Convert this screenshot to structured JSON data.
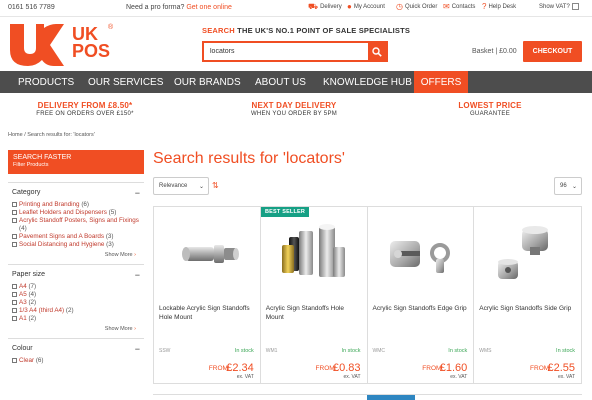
{
  "topbar": {
    "phone": "0161 516 7789",
    "proforma_text": "Need a pro forma?",
    "proforma_link": "Get one online",
    "links": [
      {
        "label": "Delivery",
        "icon": "truck-icon"
      },
      {
        "label": "My Account",
        "icon": "user-icon"
      },
      {
        "label": "Quick Order",
        "icon": "clock-icon"
      },
      {
        "label": "Contacts",
        "icon": "envelope-icon"
      },
      {
        "label": "Help Desk",
        "icon": "question-icon"
      }
    ],
    "vat_label": "Show VAT?"
  },
  "header": {
    "logo_text_1": "UK",
    "logo_text_2": "POS",
    "logo_reg": "®",
    "tagline_highlight": "SEARCH",
    "tagline_rest": "THE UK'S NO.1 POINT OF SALE SPECIALISTS",
    "search_value": "locators",
    "basket_label": "Basket",
    "basket_amount": "£0.00",
    "checkout_label": "CHECKOUT"
  },
  "nav": [
    "PRODUCTS",
    "OUR SERVICES",
    "OUR BRANDS",
    "ABOUT US",
    "KNOWLEDGE HUB",
    "OFFERS"
  ],
  "usp": [
    {
      "line1": "DELIVERY FROM £8.50*",
      "line2": "FREE ON ORDERS OVER £150*"
    },
    {
      "line1": "NEXT DAY DELIVERY",
      "line2": "WHEN YOU ORDER BY 5PM"
    },
    {
      "line1": "LOWEST PRICE",
      "line2": "GUARANTEE"
    }
  ],
  "breadcrumb": "Home / Search results for: 'locators'",
  "sidebar": {
    "title": "SEARCH FASTER",
    "subtitle": "Filter Products",
    "category": {
      "heading": "Category",
      "options": [
        {
          "label": "Printing and Branding",
          "count": "(6)"
        },
        {
          "label": "Leaflet Holders and Dispensers",
          "count": "(5)"
        },
        {
          "label": "Acrylic Standoff Posters, Signs and Fixings",
          "count": "(4)"
        },
        {
          "label": "Pavement Signs and A Boards",
          "count": "(3)"
        },
        {
          "label": "Social Distancing and Hygiene",
          "count": "(3)"
        }
      ],
      "show_more": "Show More"
    },
    "paper_size": {
      "heading": "Paper size",
      "options": [
        {
          "label": "A4",
          "count": "(7)"
        },
        {
          "label": "A5",
          "count": "(4)"
        },
        {
          "label": "A3",
          "count": "(2)"
        },
        {
          "label": "1/3 A4 (third A4)",
          "count": "(2)"
        },
        {
          "label": "A1",
          "count": "(2)"
        }
      ],
      "show_more": "Show More"
    },
    "colour": {
      "heading": "Colour",
      "options": [
        {
          "label": "Clear",
          "count": "(6)"
        }
      ]
    }
  },
  "results": {
    "title": "Search results for 'locators'",
    "sort_value": "Relevance",
    "per_page": "96",
    "badge": "BEST SELLER",
    "products": [
      {
        "name": "Lockable Acrylic Sign Standoffs Hole Mount",
        "code": "SSW",
        "stock": "In stock",
        "from": "FROM:",
        "price": "£2.34",
        "vat": "ex. VAT"
      },
      {
        "name": "Acrylic Sign Standoffs Hole Mount",
        "code": "WM1",
        "stock": "In stock",
        "from": "FROM:",
        "price": "£0.83",
        "vat": "ex. VAT"
      },
      {
        "name": "Acrylic Sign Standoffs Edge Grip",
        "code": "WMC",
        "stock": "In stock",
        "from": "FROM:",
        "price": "£1.60",
        "vat": "ex. VAT"
      },
      {
        "name": "Acrylic Sign Standoffs Side Grip",
        "code": "WMS",
        "stock": "In stock",
        "from": "FROM:",
        "price": "£2.55",
        "vat": "ex. VAT"
      }
    ]
  },
  "colors": {
    "accent": "#f04e23",
    "nav_bg": "#4d4d4d",
    "badge": "#16a085",
    "stock": "#3aa655"
  }
}
